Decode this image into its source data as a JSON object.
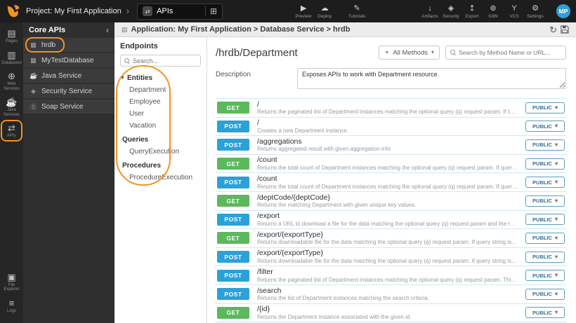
{
  "accent": "#f6921e",
  "topbar": {
    "project_label": "Project: My First Application",
    "workspace": {
      "label": "APIs",
      "icon": "apis-tab-icon"
    },
    "actions": [
      {
        "label": "Preview",
        "icon": "preview-icon"
      },
      {
        "label": "Deploy",
        "icon": "deploy-icon"
      },
      {
        "label": "Tutorials",
        "icon": "tutorials-icon"
      }
    ],
    "tools": [
      {
        "label": "Artifacts",
        "icon": "artifacts-icon"
      },
      {
        "label": "Security",
        "icon": "security-icon"
      },
      {
        "label": "Export",
        "icon": "export-icon"
      },
      {
        "label": "I18N",
        "icon": "i18n-icon"
      },
      {
        "label": "VCS",
        "icon": "vcs-icon"
      },
      {
        "label": "Settings",
        "icon": "settings-icon"
      }
    ],
    "avatar": "MP"
  },
  "rail": {
    "top": [
      {
        "label": "Pages",
        "icon": "pages-icon"
      },
      {
        "label": "Databases",
        "icon": "databases-icon"
      },
      {
        "label": "Web Services",
        "icon": "web-services-icon"
      },
      {
        "label": "Java Services",
        "icon": "java-services-icon"
      },
      {
        "label": "APIs",
        "icon": "apis-icon",
        "active": true
      }
    ],
    "bottom": [
      {
        "label": "File Explorer",
        "icon": "file-explorer-icon"
      },
      {
        "label": "Logs",
        "icon": "logs-icon"
      }
    ]
  },
  "core_apis": {
    "title": "Core APIs",
    "items": [
      {
        "label": "hrdb",
        "icon": "database-table-icon",
        "active": true
      },
      {
        "label": "MyTestDatabase",
        "icon": "database-table-icon"
      },
      {
        "label": "Java Service",
        "icon": "java-service-icon"
      },
      {
        "label": "Security Service",
        "icon": "security-service-icon"
      },
      {
        "label": "Soap Service",
        "icon": "soap-service-icon"
      }
    ]
  },
  "breadcrumb": "Application: My First Application > Database Service > hrdb",
  "endpoints": {
    "title": "Endpoints",
    "search_placeholder": "Search...",
    "tree": [
      {
        "label": "Entities",
        "kind": "group",
        "caret": "▼"
      },
      {
        "label": "Department",
        "kind": "leaf"
      },
      {
        "label": "Employee",
        "kind": "leaf"
      },
      {
        "label": "User",
        "kind": "leaf"
      },
      {
        "label": "Vacation",
        "kind": "leaf"
      },
      {
        "label": "Queries",
        "kind": "group"
      },
      {
        "label": "QueryExecution",
        "kind": "leaf"
      },
      {
        "label": "Procedures",
        "kind": "group"
      },
      {
        "label": "ProcedureExecution",
        "kind": "leaf"
      }
    ]
  },
  "api": {
    "title": "/hrdb/Department",
    "method_filter": "All Methods",
    "search_placeholder": "Search by Method Name or URL...",
    "description_label": "Description",
    "description_value": "Exposes APIs to work with Department resource.",
    "method_colors": {
      "GET": "#5cb85c",
      "POST": "#2aa1d9"
    },
    "rows": [
      {
        "method": "GET",
        "path": "/",
        "desc": "Returns the paginated list of Department instances matching the optional query (q) request param. If there is no query pro...",
        "access": "PUBLIC"
      },
      {
        "method": "POST",
        "path": "/",
        "desc": "Creates a new Department instance.",
        "access": "PUBLIC"
      },
      {
        "method": "POST",
        "path": "/aggregations",
        "desc": "Returns aggregated result with given aggregation info",
        "access": "PUBLIC"
      },
      {
        "method": "GET",
        "path": "/count",
        "desc": "Returns the total count of Department instances matching the optional query (q) request param. If query string is too big t...",
        "access": "PUBLIC"
      },
      {
        "method": "POST",
        "path": "/count",
        "desc": "Returns the total count of Department instances matching the optional query (q) request param. If query string is too big t...",
        "access": "PUBLIC"
      },
      {
        "method": "GET",
        "path": "/deptCode/{deptCode}",
        "desc": "Returns the matching Department with given unique key values.",
        "access": "PUBLIC"
      },
      {
        "method": "POST",
        "path": "/export",
        "desc": "Returns a URL to download a file for the data matching the optional query (q) request param and the required fields provid...",
        "access": "PUBLIC"
      },
      {
        "method": "GET",
        "path": "/export/{exportType}",
        "desc": "Returns downloadable file for the data matching the optional query (q) request param. If query string is too big to fit in GET...",
        "access": "PUBLIC"
      },
      {
        "method": "POST",
        "path": "/export/{exportType}",
        "desc": "Returns downloadable file for the data matching the optional query (q) request param. If query string is too big to fit in GET...",
        "access": "PUBLIC"
      },
      {
        "method": "POST",
        "path": "/filter",
        "desc": "Returns the paginated list of Department instances matching the optional query (q) request param. This API should be use...",
        "access": "PUBLIC"
      },
      {
        "method": "POST",
        "path": "/search",
        "desc": "Returns the list of Department instances matching the search criteria.",
        "access": "PUBLIC"
      },
      {
        "method": "GET",
        "path": "/{id}",
        "desc": "Returns the Department instance associated with the given id.",
        "access": "PUBLIC"
      }
    ]
  },
  "annotations": {
    "color": "#f6921e",
    "highlights": [
      "apis-rail-item",
      "hrdb-core-item",
      "endpoints-tree"
    ]
  }
}
